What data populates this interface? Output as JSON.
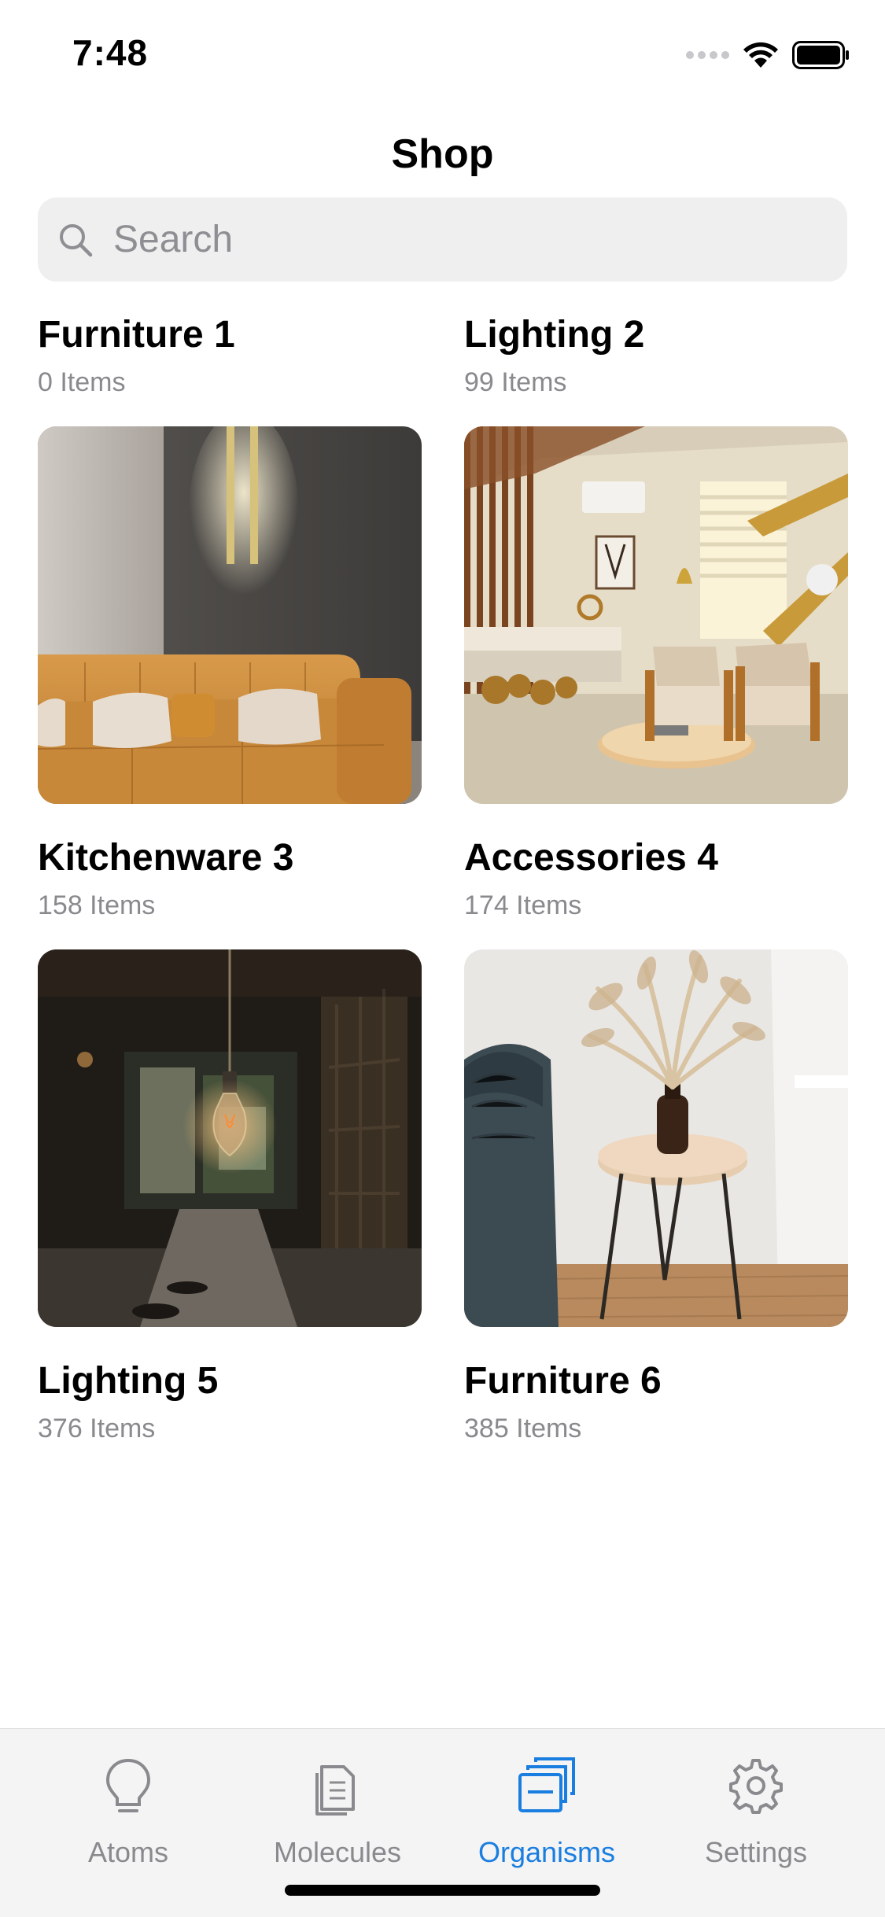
{
  "status_bar": {
    "time": "7:48"
  },
  "header": {
    "title": "Shop"
  },
  "search": {
    "placeholder": "Search"
  },
  "categories": [
    {
      "title": "Furniture 1",
      "count": "0 Items"
    },
    {
      "title": "Lighting 2",
      "count": "99 Items"
    },
    {
      "title": "Kitchenware 3",
      "count": "158 Items"
    },
    {
      "title": "Accessories 4",
      "count": "174 Items"
    },
    {
      "title": "Lighting 5",
      "count": "376 Items"
    },
    {
      "title": "Furniture 6",
      "count": "385 Items"
    }
  ],
  "tab_bar": {
    "tabs": [
      {
        "label": "Atoms",
        "icon": "lightbulb-icon",
        "active": false
      },
      {
        "label": "Molecules",
        "icon": "document-icon",
        "active": false
      },
      {
        "label": "Organisms",
        "icon": "stacked-cards-icon",
        "active": true
      },
      {
        "label": "Settings",
        "icon": "gear-icon",
        "active": false
      }
    ]
  },
  "colors": {
    "accent": "#1a7ee0",
    "inactive": "#8a8a8e",
    "search_bg": "#efeff0",
    "tab_bar_bg": "#f4f4f5"
  }
}
